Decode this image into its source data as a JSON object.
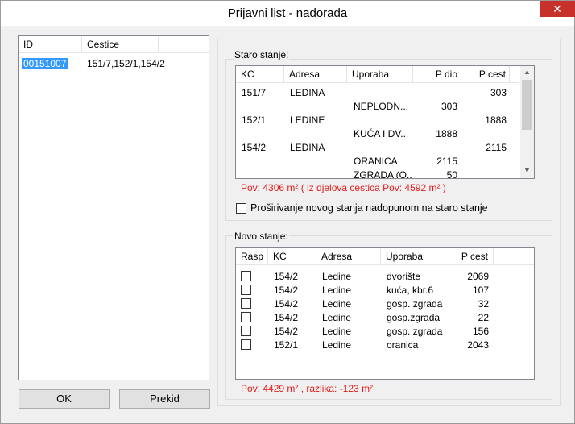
{
  "window": {
    "title": "Prijavni list - nadorada",
    "close_glyph": "✕"
  },
  "left_list": {
    "columns": [
      "ID",
      "Cestice"
    ],
    "rows": [
      {
        "id": "00151007",
        "cestice": "151/7,152/1,154/2",
        "selected": true
      }
    ]
  },
  "staro": {
    "label": "Staro stanje:",
    "columns": [
      "KC",
      "Adresa",
      "Uporaba",
      "P dio",
      "P cest"
    ],
    "rows": [
      {
        "kc": "151/7",
        "adresa": "LEDINA",
        "uporaba": "",
        "pdio": "",
        "pcest": "303"
      },
      {
        "kc": "",
        "adresa": "",
        "uporaba": "NEPLODN...",
        "pdio": "303",
        "pcest": ""
      },
      {
        "kc": "152/1",
        "adresa": "LEDINE",
        "uporaba": "",
        "pdio": "",
        "pcest": "1888"
      },
      {
        "kc": "",
        "adresa": "",
        "uporaba": "KUĆA I DV...",
        "pdio": "1888",
        "pcest": ""
      },
      {
        "kc": "154/2",
        "adresa": "LEDINA",
        "uporaba": "",
        "pdio": "",
        "pcest": "2115"
      },
      {
        "kc": "",
        "adresa": "",
        "uporaba": "ORANICA",
        "pdio": "2115",
        "pcest": ""
      },
      {
        "kc": "",
        "adresa": "",
        "uporaba": "ZGRADA (O...",
        "pdio": "50",
        "pcest": ""
      }
    ],
    "summary": "Pov: 4306 m² ( iz djelova cestica Pov: 4592 m² )"
  },
  "prosirivanje": {
    "label": "Proširivanje novog stanja nadopunom na staro stanje",
    "checked": false
  },
  "novo": {
    "label": "Novo stanje:",
    "columns": [
      "Rasp",
      "KC",
      "Adresa",
      "Uporaba",
      "P cest"
    ],
    "rows": [
      {
        "rasp": false,
        "kc": "154/2",
        "adresa": "Ledine",
        "uporaba": "dvorište",
        "pcest": "2069"
      },
      {
        "rasp": false,
        "kc": "154/2",
        "adresa": "Ledine",
        "uporaba": "kuća, kbr.6",
        "pcest": "107"
      },
      {
        "rasp": false,
        "kc": "154/2",
        "adresa": "Ledine",
        "uporaba": "gosp. zgrada",
        "pcest": "32"
      },
      {
        "rasp": false,
        "kc": "154/2",
        "adresa": "Ledine",
        "uporaba": "gosp.zgrada",
        "pcest": "22"
      },
      {
        "rasp": false,
        "kc": "154/2",
        "adresa": "Ledine",
        "uporaba": "gosp. zgrada",
        "pcest": "156"
      },
      {
        "rasp": false,
        "kc": "152/1",
        "adresa": "Ledine",
        "uporaba": "oranica",
        "pcest": "2043"
      }
    ],
    "summary": "Pov: 4429 m² , razlika: -123 m²"
  },
  "buttons": {
    "ok": "OK",
    "prekid": "Prekid"
  },
  "colors": {
    "selection": "#3399ff",
    "warning_text": "#e31b1b",
    "close_button": "#c7312a"
  }
}
